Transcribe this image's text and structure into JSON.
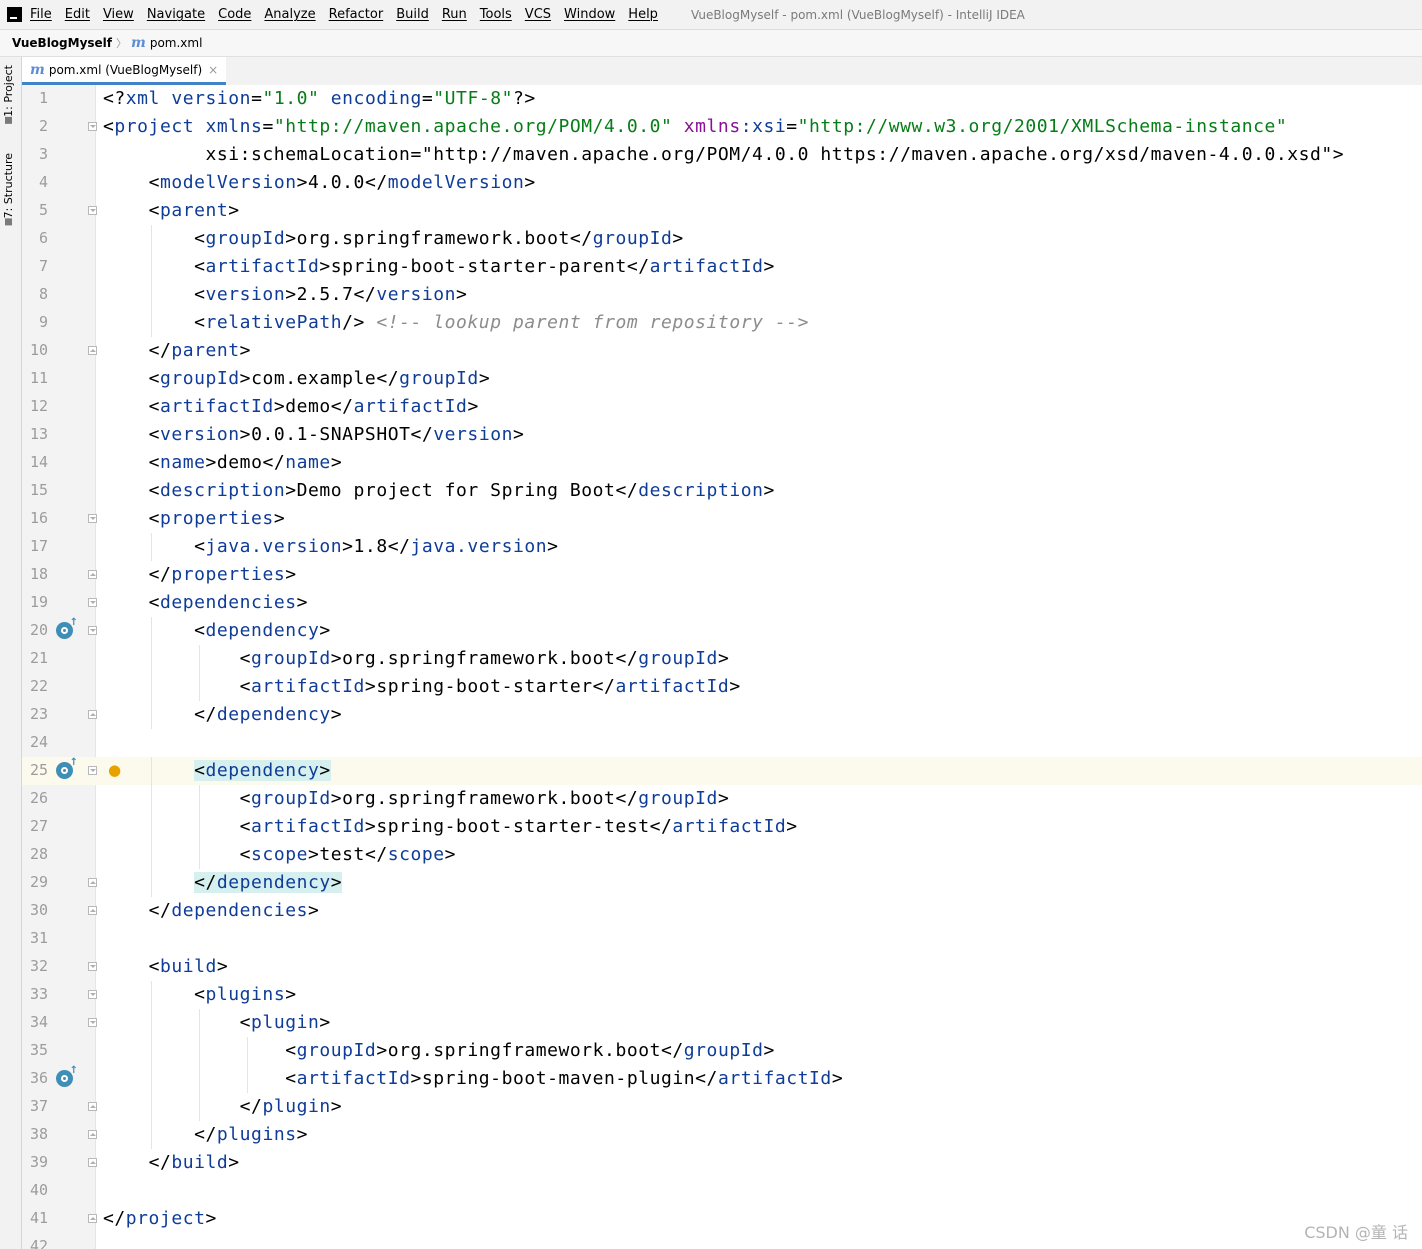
{
  "window": {
    "title": "VueBlogMyself - pom.xml (VueBlogMyself) - IntelliJ IDEA",
    "app_icon": "intellij-icon"
  },
  "menu": [
    "File",
    "Edit",
    "View",
    "Navigate",
    "Code",
    "Analyze",
    "Refactor",
    "Build",
    "Run",
    "Tools",
    "VCS",
    "Window",
    "Help"
  ],
  "breadcrumb": {
    "project": "VueBlogMyself",
    "file": "pom.xml",
    "file_icon": "m"
  },
  "sidebar": {
    "tabs": [
      "1: Project",
      "7: Structure"
    ]
  },
  "editor": {
    "tab_label": "pom.xml (VueBlogMyself)",
    "tab_icon": "m",
    "tab_close": "×",
    "current_line": 25,
    "lines": [
      "<?xml version=\"1.0\" encoding=\"UTF-8\"?>",
      "<project xmlns=\"http://maven.apache.org/POM/4.0.0\" xmlns:xsi=\"http://www.w3.org/2001/XMLSchema-instance\"",
      "         xsi:schemaLocation=\"http://maven.apache.org/POM/4.0.0 https://maven.apache.org/xsd/maven-4.0.0.xsd\">",
      "    <modelVersion>4.0.0</modelVersion>",
      "    <parent>",
      "        <groupId>org.springframework.boot</groupId>",
      "        <artifactId>spring-boot-starter-parent</artifactId>",
      "        <version>2.5.7</version>",
      "        <relativePath/> <!-- lookup parent from repository -->",
      "    </parent>",
      "    <groupId>com.example</groupId>",
      "    <artifactId>demo</artifactId>",
      "    <version>0.0.1-SNAPSHOT</version>",
      "    <name>demo</name>",
      "    <description>Demo project for Spring Boot</description>",
      "    <properties>",
      "        <java.version>1.8</java.version>",
      "    </properties>",
      "    <dependencies>",
      "        <dependency>",
      "            <groupId>org.springframework.boot</groupId>",
      "            <artifactId>spring-boot-starter</artifactId>",
      "        </dependency>",
      "",
      "        <dependency>",
      "            <groupId>org.springframework.boot</groupId>",
      "            <artifactId>spring-boot-starter-test</artifactId>",
      "            <scope>test</scope>",
      "        </dependency>",
      "    </dependencies>",
      "",
      "    <build>",
      "        <plugins>",
      "            <plugin>",
      "                <groupId>org.springframework.boot</groupId>",
      "                <artifactId>spring-boot-maven-plugin</artifactId>",
      "            </plugin>",
      "        </plugins>",
      "    </build>",
      "",
      "</project>",
      ""
    ],
    "fold_open_lines": [
      2,
      5,
      16,
      19,
      20,
      25,
      32,
      33,
      34
    ],
    "fold_close_lines": [
      10,
      18,
      23,
      29,
      30,
      37,
      38,
      39,
      41
    ],
    "maven_gutter_icon_lines": [
      20,
      25,
      36
    ],
    "intention_bulb_line": 25,
    "highlighted_tag_lines": [
      25,
      29
    ],
    "gutter_icon_name": "maven-dependency-icon",
    "bulb_icon_name": "lightbulb-icon"
  },
  "watermark": "CSDN @童  话",
  "colors": {
    "tag": "#0f3c97",
    "string": "#067d17",
    "namespace": "#871094",
    "comment": "#8c8c8c",
    "current_line": "#fcfaed",
    "tag_match": "#d5f0ef",
    "tab_accent": "#4083c9"
  }
}
